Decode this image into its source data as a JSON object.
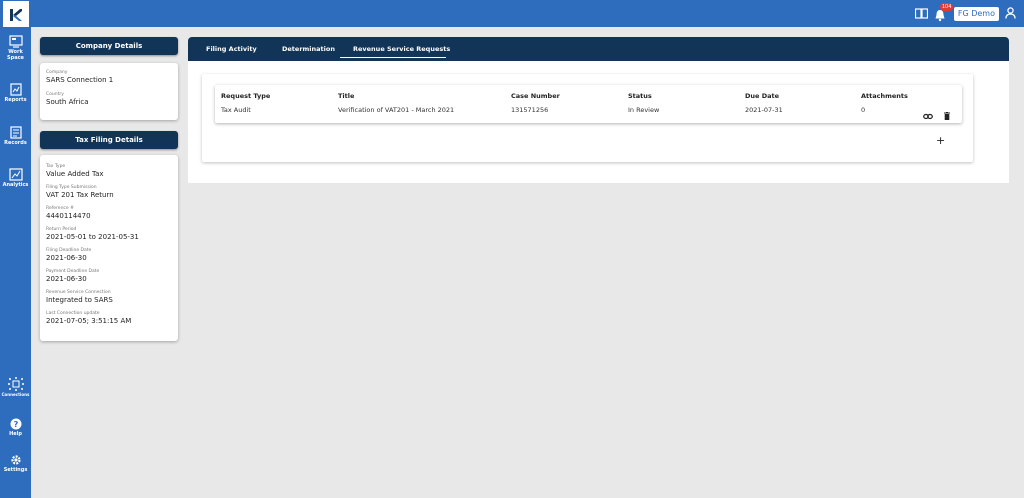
{
  "app": {
    "logo_letter": "K",
    "notification_count": "104",
    "user_name": "FG Demo"
  },
  "sidebar": {
    "items": [
      {
        "label": "Work Space",
        "icon": "workspace-icon"
      },
      {
        "label": "Reports",
        "icon": "reports-icon"
      },
      {
        "label": "Records",
        "icon": "records-icon"
      },
      {
        "label": "Analytics",
        "icon": "analytics-icon"
      },
      {
        "label": "Connections",
        "icon": "connections-icon"
      },
      {
        "label": "Help",
        "icon": "help-icon"
      },
      {
        "label": "Settings",
        "icon": "settings-icon"
      }
    ]
  },
  "company": {
    "heading": "Company Details",
    "company_label": "Company",
    "company_value": "SARS Connection 1",
    "country_label": "Country",
    "country_value": "South Africa"
  },
  "tax": {
    "heading": "Tax Filing Details",
    "fields": [
      {
        "label": "Tax Type",
        "value": "Value Added Tax"
      },
      {
        "label": "Filing Type Submission",
        "value": "VAT 201 Tax Return"
      },
      {
        "label": "Reference #",
        "value": "4440114470"
      },
      {
        "label": "Return Period",
        "value": "2021-05-01 to 2021-05-31"
      },
      {
        "label": "Filing Deadline Date",
        "value": "2021-06-30"
      },
      {
        "label": "Payment Deadline Date",
        "value": "2021-06-30"
      },
      {
        "label": "Revenue Service Connection",
        "value": "Integrated to SARS"
      },
      {
        "label": "Last Connection update",
        "value": "2021-07-05; 3:51:15 AM"
      }
    ]
  },
  "tabs": [
    {
      "label": "Filing Activity",
      "active": false
    },
    {
      "label": "Determination",
      "active": false
    },
    {
      "label": "Revenue Service Requests",
      "active": true
    }
  ],
  "table": {
    "columns": [
      "Request Type",
      "Title",
      "Case Number",
      "Status",
      "Due Date",
      "Attachments"
    ],
    "rows": [
      [
        "Tax Audit",
        "Verification of VAT201 - March 2021",
        "131571256",
        "In Review",
        "2021-07-31",
        "0"
      ]
    ],
    "add_label": "+"
  },
  "colors": {
    "brand_blue": "#2e6dbe",
    "navy": "#113457"
  }
}
